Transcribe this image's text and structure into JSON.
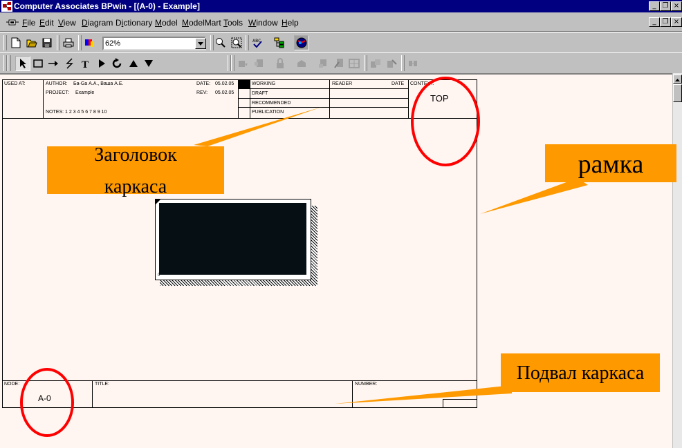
{
  "window": {
    "title": "Computer Associates BPwin - [(A-0)  - Example]",
    "controls": [
      "_",
      "❐",
      "×"
    ]
  },
  "menu": {
    "items": [
      {
        "label": "File",
        "accel": "F",
        "rest": "ile"
      },
      {
        "label": "Edit",
        "accel": "E",
        "rest": "dit"
      },
      {
        "label": "View",
        "accel": "V",
        "rest": "iew"
      },
      {
        "label": "Diagram",
        "accel": "D",
        "rest": "iagram"
      },
      {
        "label": "Dictionary",
        "accel": "i",
        "pre": "D",
        "rest": "ctionary"
      },
      {
        "label": "Model",
        "accel": "M",
        "rest": "odel"
      },
      {
        "label": "ModelMart",
        "accel": "M",
        "rest": "odelMart"
      },
      {
        "label": "Tools",
        "accel": "T",
        "rest": "ools"
      },
      {
        "label": "Window",
        "accel": "W",
        "rest": "indow"
      },
      {
        "label": "Help",
        "accel": "H",
        "rest": "elp"
      }
    ]
  },
  "toolbar": {
    "zoom_value": "62%"
  },
  "diagram": {
    "header": {
      "used_at": "USED AT:",
      "author_label": "AUTHOR:",
      "author_value": "Ба-Gа A.A., Ваша A.E.",
      "project_label": "PROJECT:",
      "project_value": "Example",
      "notes": "NOTES: 1 2 3 4 5 6 7 8 9 10",
      "date_label": "DATE:",
      "date_value": "05.02.05",
      "rev_label": "REV:",
      "rev_value": "05.02.05",
      "statuses": [
        "WORKING",
        "DRAFT",
        "RECOMMENDED",
        "PUBLICATION"
      ],
      "reader": "READER",
      "date": "DATE",
      "context_label": "CONTEXT:",
      "context_value": "TOP"
    },
    "footer": {
      "node_label": "NODE:",
      "node_value": "A-0",
      "title_label": "TITLE:",
      "number_label": "NUMBER:"
    }
  },
  "annotations": {
    "header_callout": {
      "line1": "Заголовок",
      "line2": "каркаса"
    },
    "frame_callout": "рамка",
    "footer_callout": "Подвал каркаса"
  },
  "colors": {
    "titlebar": "#000080",
    "canvas": "#fff6f1",
    "callout": "#ff9900",
    "circle": "#ff0000"
  }
}
